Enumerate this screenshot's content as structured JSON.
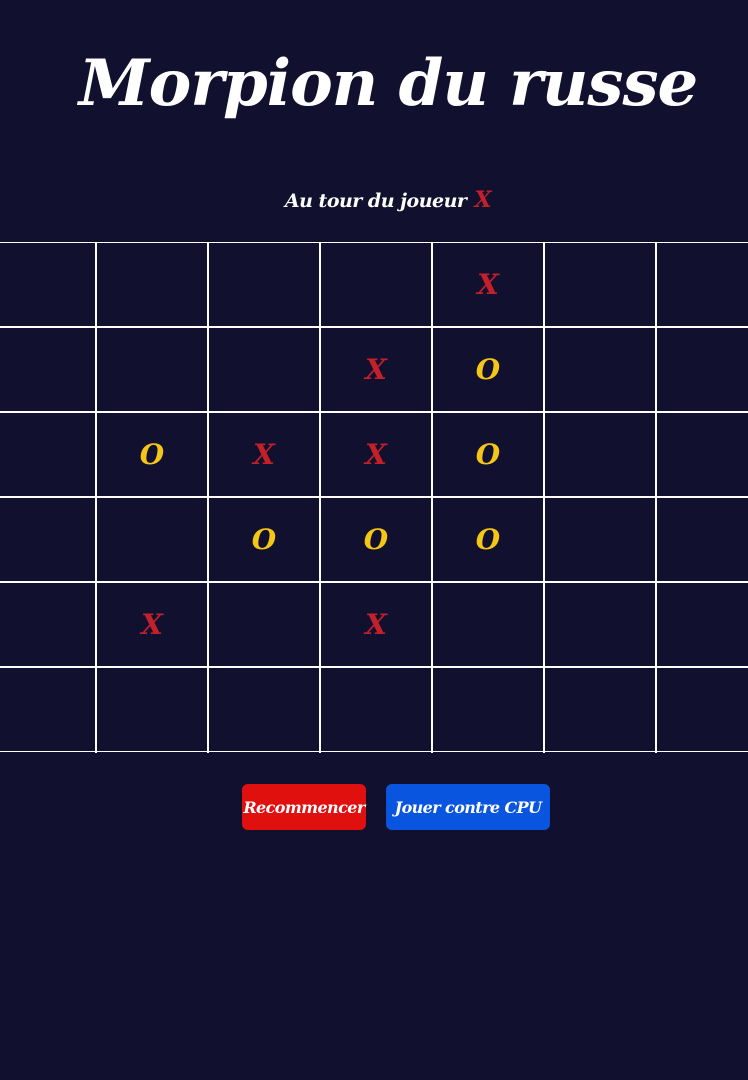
{
  "title": "Morpion du russe",
  "status": {
    "prefix": "Au tour du joueur",
    "current_player": "X"
  },
  "colors": {
    "background": "#11112f",
    "x": "#c4202a",
    "o": "#f5c518",
    "restart_button": "#e0100f",
    "cpu_button": "#0a55df"
  },
  "board": {
    "rows": [
      [
        "",
        "",
        "",
        "",
        "X",
        "",
        ""
      ],
      [
        "",
        "",
        "",
        "X",
        "O",
        "",
        ""
      ],
      [
        "",
        "O",
        "X",
        "X",
        "O",
        "",
        ""
      ],
      [
        "",
        "",
        "O",
        "O",
        "O",
        "",
        ""
      ],
      [
        "",
        "X",
        "",
        "X",
        "",
        "",
        ""
      ],
      [
        "",
        "",
        "",
        "",
        "",
        "",
        ""
      ]
    ]
  },
  "buttons": {
    "restart_label": "Recommencer",
    "cpu_label": "Jouer contre CPU"
  }
}
